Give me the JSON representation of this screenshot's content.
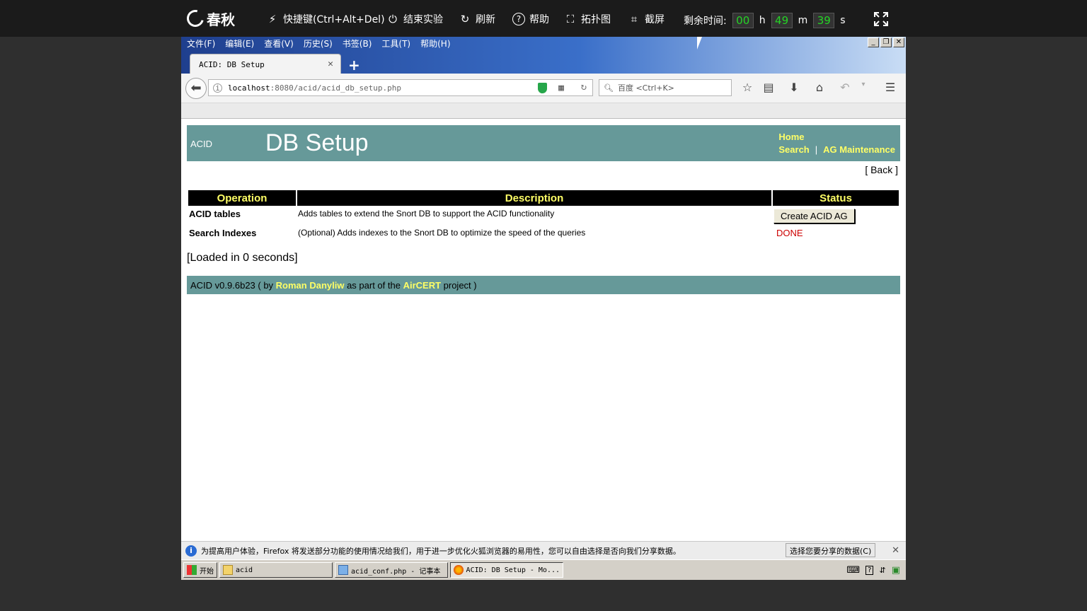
{
  "labbar": {
    "logo": "春秋",
    "shortcut": "快捷键(Ctrl+Alt+Del)",
    "end_experiment": "结束实验",
    "refresh": "刷新",
    "help": "帮助",
    "topology": "拓扑图",
    "screenshot": "截屏",
    "remaining_label": "剩余时间:",
    "hours": "00",
    "h": "h",
    "minutes": "49",
    "m": "m",
    "seconds": "39",
    "s": "s"
  },
  "browser": {
    "menu": [
      "文件(F)",
      "编辑(E)",
      "查看(V)",
      "历史(S)",
      "书签(B)",
      "工具(T)",
      "帮助(H)"
    ],
    "tab_title": "ACID: DB Setup",
    "url_host": "localhost",
    "url_path": ":8080/acid/acid_db_setup.php",
    "search_placeholder": "百度 <Ctrl+K>"
  },
  "page": {
    "header_small": "ACID",
    "header_title": "DB Setup",
    "link_home": "Home",
    "link_search": "Search",
    "link_sep": "|",
    "link_ag": "AG Maintenance",
    "back": "[ Back ]",
    "table": {
      "headers": [
        "Operation",
        "Description",
        "Status"
      ],
      "rows": [
        {
          "op": "ACID tables",
          "desc": "Adds tables to extend the Snort DB to support the ACID functionality",
          "status_button": "Create ACID AG"
        },
        {
          "op": "Search Indexes",
          "desc": "(Optional) Adds indexes to the Snort DB to optimize the speed of the queries",
          "status_text": "DONE"
        }
      ]
    },
    "loaded": "[Loaded in 0 seconds]",
    "footer": {
      "pre": "ACID v0.9.6b23 ( by ",
      "author": "Roman Danyliw",
      "mid": " as part of the ",
      "project": "AirCERT",
      "post": " project )"
    }
  },
  "notification": {
    "message": "为提高用户体验，Firefox 将发送部分功能的使用情况给我们，用于进一步优化火狐浏览器的易用性，您可以自由选择是否向我们分享数据。",
    "choose_button": "选择您要分享的数据(C)"
  },
  "taskbar": {
    "start": "开始",
    "items": [
      "acid",
      "acid_conf.php - 记事本",
      "ACID: DB Setup - Mo..."
    ]
  }
}
